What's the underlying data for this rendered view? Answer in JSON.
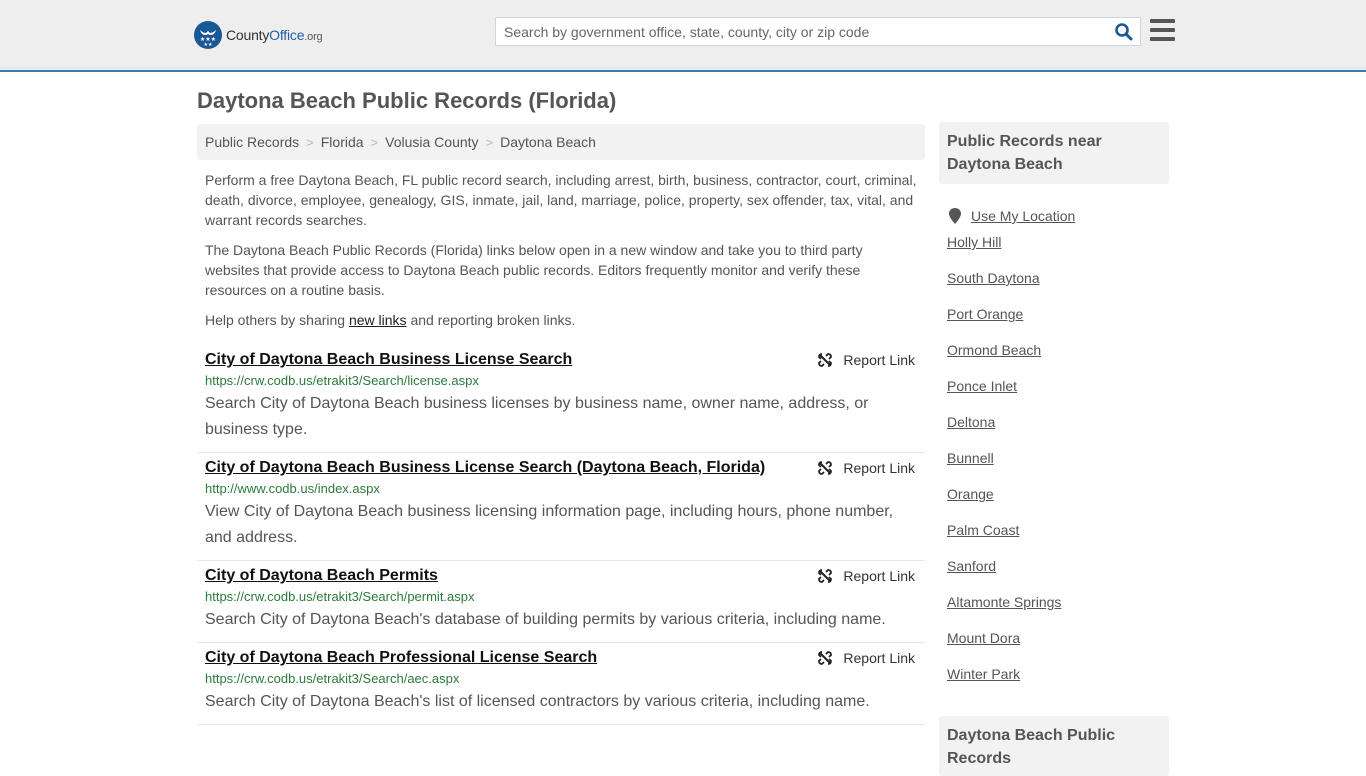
{
  "header": {
    "logo": {
      "name_part1": "County",
      "name_part2": "Office",
      "tld": ".org"
    },
    "search": {
      "placeholder": "Search by government office, state, county, city or zip code",
      "value": ""
    },
    "icons": {
      "search": "search-icon",
      "menu": "hamburger-menu-icon"
    }
  },
  "page": {
    "title": "Daytona Beach Public Records (Florida)"
  },
  "breadcrumb": [
    {
      "label": "Public Records"
    },
    {
      "label": "Florida"
    },
    {
      "label": "Volusia County"
    },
    {
      "label": "Daytona Beach"
    }
  ],
  "breadcrumb_separator": ">",
  "intro": {
    "p1": "Perform a free Daytona Beach, FL public record search, including arrest, birth, business, contractor, court, criminal, death, divorce, employee, genealogy, GIS, inmate, jail, land, marriage, police, property, sex offender, tax, vital, and warrant records searches.",
    "p2": "The Daytona Beach Public Records (Florida) links below open in a new window and take you to third party websites that provide access to Daytona Beach public records. Editors frequently monitor and verify these resources on a routine basis.",
    "p3_before": "Help others by sharing ",
    "p3_link": "new links",
    "p3_after": " and reporting broken links."
  },
  "report_label": "Report Link",
  "results": [
    {
      "title": "City of Daytona Beach Business License Search",
      "url": "https://crw.codb.us/etrakit3/Search/license.aspx",
      "description": "Search City of Daytona Beach business licenses by business name, owner name, address, or business type."
    },
    {
      "title": "City of Daytona Beach Business License Search (Daytona Beach, Florida)",
      "url": "http://www.codb.us/index.aspx",
      "description": "View City of Daytona Beach business licensing information page, including hours, phone number, and address."
    },
    {
      "title": "City of Daytona Beach Permits",
      "url": "https://crw.codb.us/etrakit3/Search/permit.aspx",
      "description": "Search City of Daytona Beach's database of building permits by various criteria, including name."
    },
    {
      "title": "City of Daytona Beach Professional License Search",
      "url": "https://crw.codb.us/etrakit3/Search/aec.aspx",
      "description": "Search City of Daytona Beach's list of licensed contractors by various criteria, including name."
    }
  ],
  "sidebar": {
    "heading": "Public Records near Daytona Beach",
    "use_location": "Use My Location",
    "nearby": [
      "Holly Hill",
      "South Daytona",
      "Port Orange",
      "Ormond Beach",
      "Ponce Inlet",
      "Deltona",
      "Bunnell",
      "Orange",
      "Palm Coast",
      "Sanford",
      "Altamonte Springs",
      "Mount Dora",
      "Winter Park"
    ],
    "heading2": "Daytona Beach Public Records"
  },
  "colors": {
    "brand_blue": "#1a5796",
    "header_border": "#3b7bab",
    "url_green": "#2c7a3a"
  }
}
